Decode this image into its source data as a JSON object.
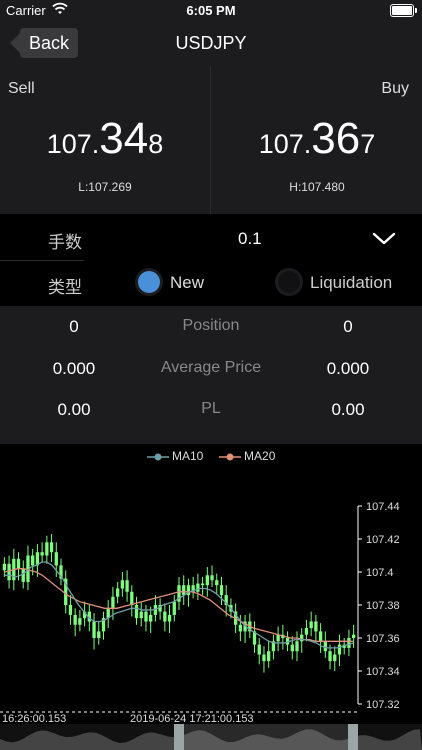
{
  "status_bar": {
    "carrier": "Carrier",
    "time": "6:05 PM"
  },
  "navbar": {
    "back_label": "Back",
    "title": "USDJPY"
  },
  "quotes": {
    "sell": {
      "label": "Sell",
      "price_prefix": "107.",
      "price_big": "34",
      "price_suffix": "8",
      "range": "L:107.269"
    },
    "buy": {
      "label": "Buy",
      "price_prefix": "107.",
      "price_big": "36",
      "price_suffix": "7",
      "range": "H:107.480"
    }
  },
  "order": {
    "lot_label": "手数",
    "lot_value": "0.1",
    "type_label": "类型",
    "type_options": [
      "New",
      "Liquidation"
    ],
    "type_selected": "New"
  },
  "position": {
    "rows": [
      {
        "left": "0",
        "label": "Position",
        "right": "0"
      },
      {
        "left": "0.000",
        "label": "Average Price",
        "right": "0.000"
      },
      {
        "left": "0.00",
        "label": "PL",
        "right": "0.00"
      }
    ]
  },
  "chart_data": {
    "type": "candlestick",
    "legend": [
      {
        "name": "MA10",
        "color": "#6f9fa8"
      },
      {
        "name": "MA20",
        "color": "#e0907a"
      }
    ],
    "y_ticks": [
      "107.44",
      "107.42",
      "107.4",
      "107.38",
      "107.36",
      "107.34",
      "107.32"
    ],
    "ylim": [
      107.32,
      107.44
    ],
    "x_labels": [
      "16:26:00.153",
      "2019-06-24 17:21:00.153"
    ],
    "up_color": "#7dff7d",
    "down_color": "#7dff7d",
    "close_series": [
      107.405,
      107.395,
      107.408,
      107.402,
      107.394,
      107.41,
      107.404,
      107.412,
      107.41,
      107.418,
      107.412,
      107.404,
      107.396,
      107.38,
      107.374,
      107.368,
      107.372,
      107.376,
      107.37,
      107.36,
      107.364,
      107.372,
      107.378,
      107.385,
      107.39,
      107.395,
      107.388,
      107.38,
      107.372,
      107.376,
      107.37,
      107.374,
      107.38,
      107.376,
      107.37,
      107.374,
      107.382,
      107.392,
      107.386,
      107.392,
      107.388,
      107.393,
      107.392,
      107.398,
      107.395,
      107.392,
      107.386,
      107.38,
      107.376,
      107.368,
      107.364,
      107.37,
      107.364,
      107.356,
      107.35,
      107.346,
      107.352,
      107.358,
      107.362,
      107.36,
      107.356,
      107.352,
      107.358,
      107.362,
      107.366,
      107.37,
      107.364,
      107.358,
      107.352,
      107.346,
      107.35,
      107.356,
      107.354,
      107.36,
      107.362
    ],
    "ma10": [
      107.398,
      107.398,
      107.397,
      107.398,
      107.4,
      107.403,
      107.404,
      107.406,
      107.406,
      107.404,
      107.4,
      107.396,
      107.39,
      107.385,
      107.38,
      107.376,
      107.372,
      107.37,
      107.37,
      107.371,
      107.373,
      107.375,
      107.376,
      107.377,
      107.378,
      107.378,
      107.377,
      107.377,
      107.377,
      107.378,
      107.38,
      107.381,
      107.382,
      107.384,
      107.386,
      107.388,
      107.389,
      107.39,
      107.39,
      107.389,
      107.387,
      107.384,
      107.381,
      107.377,
      107.373,
      107.369,
      107.366,
      107.364,
      107.362,
      107.36,
      107.358,
      107.357,
      107.357,
      107.357,
      107.358,
      107.359,
      107.359,
      107.359,
      107.358,
      107.357,
      107.355,
      107.354,
      107.354,
      107.354,
      107.355,
      107.356,
      107.357
    ],
    "ma20": [
      107.4,
      107.401,
      107.402,
      107.402,
      107.401,
      107.4,
      107.398,
      107.395,
      107.392,
      107.389,
      107.386,
      107.384,
      107.382,
      107.381,
      107.38,
      107.379,
      107.378,
      107.378,
      107.378,
      107.379,
      107.38,
      107.381,
      107.382,
      107.383,
      107.384,
      107.385,
      107.386,
      107.387,
      107.388,
      107.388,
      107.388,
      107.387,
      107.385,
      107.383,
      107.38,
      107.377,
      107.374,
      107.372,
      107.37,
      107.368,
      107.366,
      107.365,
      107.364,
      107.363,
      107.362,
      107.361,
      107.36,
      107.36,
      107.359,
      107.359,
      107.358,
      107.358,
      107.358,
      107.358,
      107.358,
      107.358,
      107.358
    ]
  }
}
